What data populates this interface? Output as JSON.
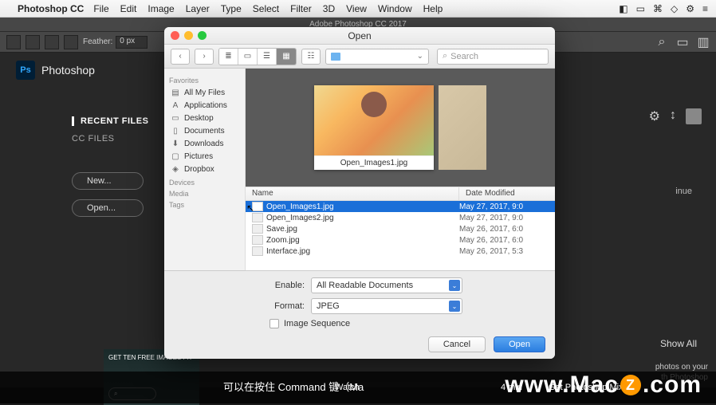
{
  "mac_menu": {
    "app": "Photoshop CC",
    "items": [
      "File",
      "Edit",
      "Image",
      "Layer",
      "Type",
      "Select",
      "Filter",
      "3D",
      "View",
      "Window",
      "Help"
    ],
    "right_icons": [
      "◧",
      "▭",
      "⌘",
      "◇",
      "⚙",
      "≡"
    ]
  },
  "ps": {
    "title": "Adobe Photoshop CC 2017",
    "feather_label": "Feather:",
    "feather_value": "0 px",
    "product": "Photoshop",
    "logo": "Ps",
    "tabs": {
      "recent": "RECENT FILES",
      "cc": "CC FILES"
    },
    "buttons": {
      "new": "New...",
      "open": "Open..."
    },
    "continue": "inue",
    "showall": "Show All",
    "promo_lines": [
      "photos on your",
      "th Photoshop"
    ],
    "promo_card": "GET TEN FREE IMAGES FR",
    "search_glyph": "⌕"
  },
  "dialog": {
    "title": "Open",
    "nav": {
      "back": "‹",
      "fwd": "›"
    },
    "view_modes": [
      "≣",
      "▭",
      "☰",
      "▦",
      "☷",
      "⋮"
    ],
    "path_placeholder": "",
    "search_placeholder": "Search",
    "search_icon": "⌕",
    "sidebar": {
      "sections": [
        {
          "label": "Favorites",
          "items": [
            {
              "icon": "▤",
              "label": "All My Files"
            },
            {
              "icon": "A",
              "label": "Applications"
            },
            {
              "icon": "▭",
              "label": "Desktop"
            },
            {
              "icon": "▯",
              "label": "Documents"
            },
            {
              "icon": "⬇",
              "label": "Downloads"
            },
            {
              "icon": "▢",
              "label": "Pictures"
            },
            {
              "icon": "◈",
              "label": "Dropbox"
            }
          ]
        },
        {
          "label": "Devices",
          "items": []
        },
        {
          "label": "Media",
          "items": []
        },
        {
          "label": "Tags",
          "items": []
        }
      ]
    },
    "preview_caption": "Open_Images1.jpg",
    "columns": {
      "name": "Name",
      "date": "Date Modified"
    },
    "files": [
      {
        "name": "Open_Images1.jpg",
        "date": "May 27, 2017, 9:0",
        "selected": true
      },
      {
        "name": "Open_Images2.jpg",
        "date": "May 27, 2017, 9:0"
      },
      {
        "name": "Save.jpg",
        "date": "May 26, 2017, 6:0"
      },
      {
        "name": "Zoom.jpg",
        "date": "May 26, 2017, 6:0"
      },
      {
        "name": "Interface.jpg",
        "date": "May 26, 2017, 5:3"
      }
    ],
    "enable_label": "Enable:",
    "enable_value": "All Readable Documents",
    "format_label": "Format:",
    "format_value": "JPEG",
    "image_seq": "Image Sequence",
    "cancel": "Cancel",
    "open": "Open"
  },
  "footer": {
    "subtitle": "可以在按住 Command 键（Ma",
    "watch": "Watch",
    "min": "4 min",
    "mix": "Get Photoshop Mix",
    "watermark_pre": "www.Mac",
    "watermark_mid": "Z",
    "watermark_post": ".com"
  }
}
